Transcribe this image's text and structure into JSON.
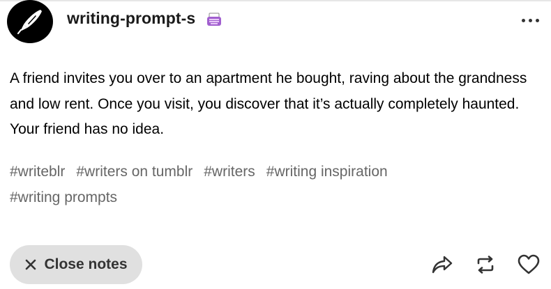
{
  "post": {
    "blog_name": "writing-prompt-s",
    "blog_emoji": "typewriter-icon",
    "avatar_icon": "quill-pen-icon",
    "more_icon": "more-options-icon",
    "body": "A friend invites you over to an apartment he bought, raving about the grandness and low rent. Once you visit, you discover that it’s actually completely haunted. Your friend has no idea.",
    "tags": [
      "#writeblr",
      "#writers on tumblr",
      "#writers",
      "#writing inspiration",
      "#writing prompts"
    ]
  },
  "footer": {
    "close_notes_label": "Close notes",
    "close_icon": "close-icon",
    "actions": [
      {
        "name": "share",
        "icon": "share-icon"
      },
      {
        "name": "reblog",
        "icon": "reblog-icon"
      },
      {
        "name": "like",
        "icon": "heart-icon"
      }
    ]
  },
  "colors": {
    "text": "#000000",
    "tag_text": "#666666",
    "button_bg": "#e0e0e0",
    "avatar_bg": "#000000",
    "emoji_purple": "#a15fcf"
  }
}
